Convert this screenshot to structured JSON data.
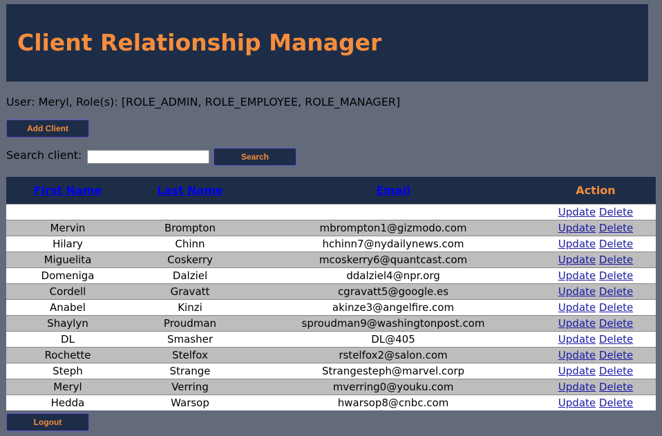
{
  "header": {
    "title": "Client Relationship Manager"
  },
  "user_info": "User: Meryl, Role(s): [ROLE_ADMIN, ROLE_EMPLOYEE, ROLE_MANAGER]",
  "buttons": {
    "add_client": "Add Client",
    "search": "Search",
    "logout": "Logout"
  },
  "search": {
    "label": "Search client:",
    "value": "",
    "placeholder": ""
  },
  "table": {
    "columns": {
      "first_name": "First Name",
      "last_name": "Last Name",
      "email": "Email",
      "action": "Action"
    },
    "update_label": "Update",
    "delete_label": "Delete",
    "rows": [
      {
        "first": "",
        "last": "",
        "email": ""
      },
      {
        "first": "Mervin",
        "last": "Brompton",
        "email": "mbrompton1@gizmodo.com"
      },
      {
        "first": "Hilary",
        "last": "Chinn",
        "email": "hchinn7@nydailynews.com"
      },
      {
        "first": "Miguelita",
        "last": "Coskerry",
        "email": "mcoskerry6@quantcast.com"
      },
      {
        "first": "Domeniga",
        "last": "Dalziel",
        "email": "ddalziel4@npr.org"
      },
      {
        "first": "Cordell",
        "last": "Gravatt",
        "email": "cgravatt5@google.es"
      },
      {
        "first": "Anabel",
        "last": "Kinzi",
        "email": "akinze3@angelfire.com"
      },
      {
        "first": "Shaylyn",
        "last": "Proudman",
        "email": "sproudman9@washingtonpost.com"
      },
      {
        "first": "DL",
        "last": "Smasher",
        "email": "DL@405"
      },
      {
        "first": "Rochette",
        "last": "Stelfox",
        "email": "rstelfox2@salon.com"
      },
      {
        "first": "Steph",
        "last": "Strange",
        "email": "Strangesteph@marvel.corp"
      },
      {
        "first": "Meryl",
        "last": "Verring",
        "email": "mverring0@youku.com"
      },
      {
        "first": "Hedda",
        "last": "Warsop",
        "email": "hwarsop8@cnbc.com"
      }
    ]
  },
  "colors": {
    "background": "#636b7b",
    "header_bg": "#1e2d47",
    "accent_orange": "#f58d3c",
    "link_blue": "#0000ee"
  }
}
